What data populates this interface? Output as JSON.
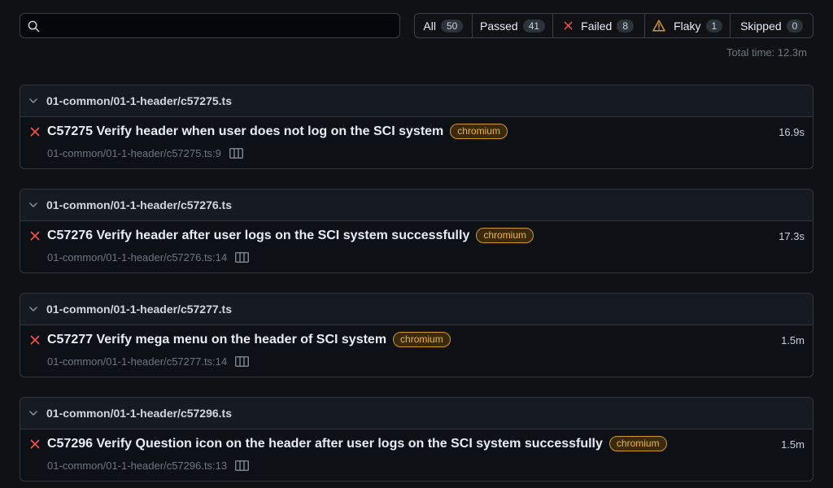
{
  "search": {
    "placeholder": "",
    "value": ""
  },
  "filters": [
    {
      "label": "All",
      "count": "50"
    },
    {
      "label": "Passed",
      "count": "41"
    },
    {
      "label": "Failed",
      "count": "8"
    },
    {
      "label": "Flaky",
      "count": "1"
    },
    {
      "label": "Skipped",
      "count": "0"
    }
  ],
  "total_time": "Total time: 12.3m",
  "files": [
    {
      "path": "01-common/01-1-header/c57275.ts",
      "test": {
        "title": "C57275 Verify header when user does not log on the SCI system",
        "tag": "chromium",
        "duration": "16.9s",
        "location": "01-common/01-1-header/c57275.ts:9"
      }
    },
    {
      "path": "01-common/01-1-header/c57276.ts",
      "test": {
        "title": "C57276 Verify header after user logs on the SCI system successfully",
        "tag": "chromium",
        "duration": "17.3s",
        "location": "01-common/01-1-header/c57276.ts:14"
      }
    },
    {
      "path": "01-common/01-1-header/c57277.ts",
      "test": {
        "title": "C57277 Verify mega menu on the header of SCI system",
        "tag": "chromium",
        "duration": "1.5m",
        "location": "01-common/01-1-header/c57277.ts:14"
      }
    },
    {
      "path": "01-common/01-1-header/c57296.ts",
      "test": {
        "title": "C57296 Verify Question icon on the header after user logs on the SCI system successfully",
        "tag": "chromium",
        "duration": "1.5m",
        "location": "01-common/01-1-header/c57296.ts:13"
      }
    }
  ],
  "colors": {
    "background": "#0f1115",
    "failed": "#f85149",
    "flaky": "#d29922",
    "tag_text": "#f0b542"
  },
  "icons": {
    "search": "search-icon",
    "failed": "x-icon",
    "flaky": "warning-triangle-icon",
    "chevron": "chevron-down-icon",
    "trace": "trace-viewer-icon"
  }
}
